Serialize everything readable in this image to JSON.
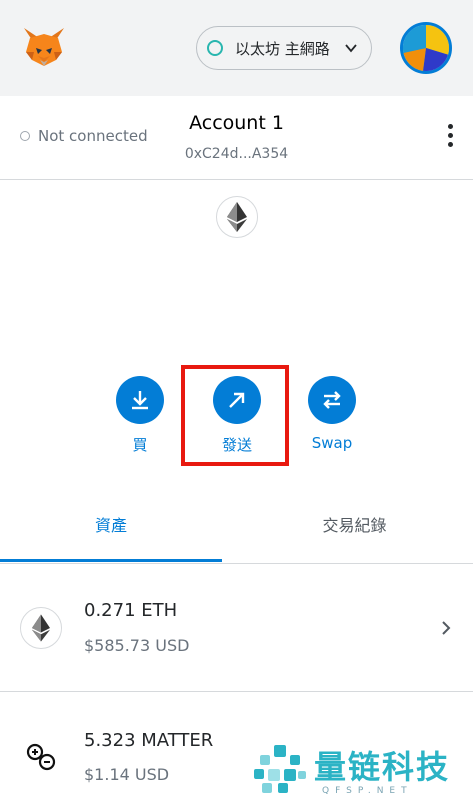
{
  "header": {
    "network_label": "以太坊 主網路"
  },
  "account": {
    "connection_status": "Not connected",
    "name": "Account 1",
    "address": "0xC24d...A354"
  },
  "actions": {
    "buy": "買",
    "send": "發送",
    "swap": "Swap"
  },
  "tabs": {
    "assets": "資產",
    "activity": "交易紀錄"
  },
  "assets": [
    {
      "amount": "0.271 ETH",
      "usd": "$585.73 USD",
      "icon": "ethereum-icon"
    },
    {
      "amount": "5.323 MATTER",
      "usd": "$1.14 USD",
      "icon": "matter-token-icon"
    }
  ],
  "watermark": {
    "text": "量链科技",
    "sub": "QFSP.NET"
  },
  "colors": {
    "accent": "#037dd6",
    "highlight": "#e8190f",
    "network_dot": "#29b6af"
  }
}
